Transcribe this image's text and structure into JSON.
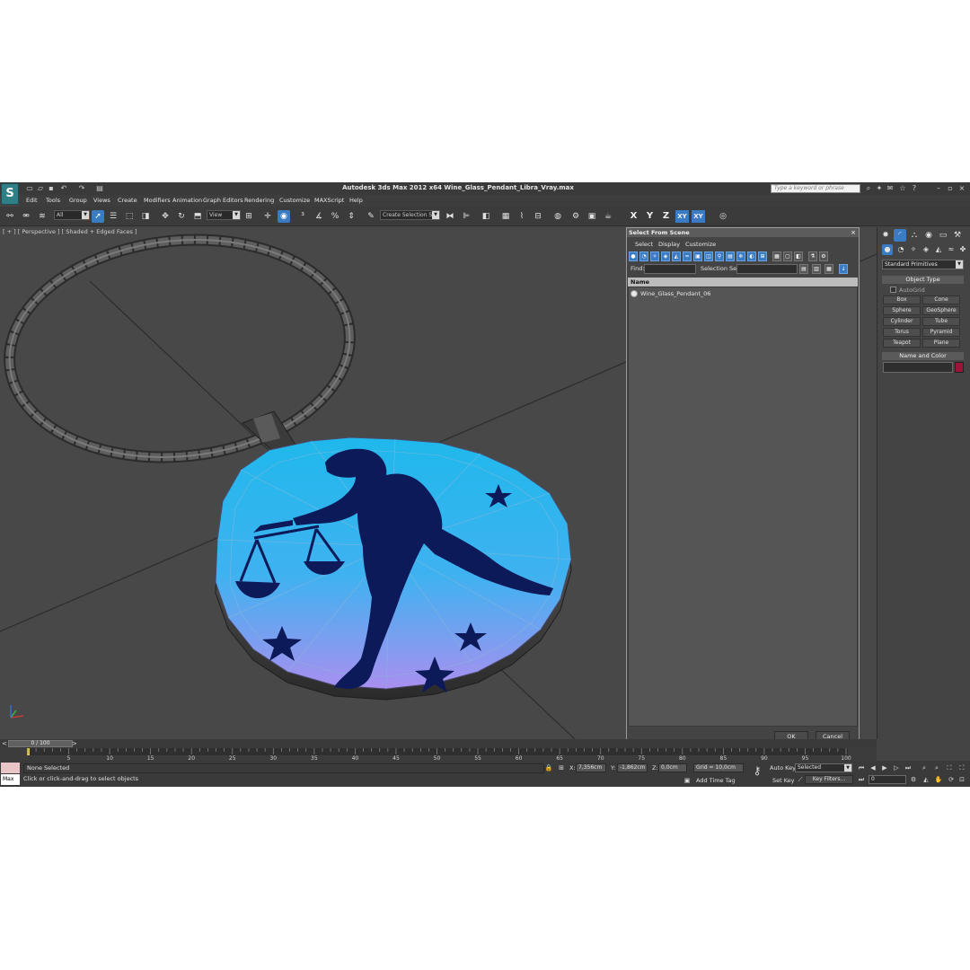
{
  "window": {
    "title": "Autodesk 3ds Max  2012 x64     Wine_Glass_Pendant_Libra_Vray.max",
    "search_placeholder": "Type a keyword or phrase",
    "logo": "S"
  },
  "menu": [
    "Edit",
    "Tools",
    "Group",
    "Views",
    "Create",
    "Modifiers",
    "Animation",
    "Graph Editors",
    "Rendering",
    "Customize",
    "MAXScript",
    "Help"
  ],
  "toolbar": {
    "selection_filter": "All",
    "reference_coord": "View",
    "named_selection": "Create Selection Se",
    "axis_x": "X",
    "axis_y": "Y",
    "axis_z": "Z",
    "axis_xy": "XY",
    "axis_xy2": "XY"
  },
  "viewport": {
    "label": "[ + ] [ Perspective ] [ Shaded + Edged Faces ]"
  },
  "dialog": {
    "title": "Select From Scene",
    "menu": [
      "Select",
      "Display",
      "Customize"
    ],
    "find_label": "Find:",
    "selection_set_label": "Selection Set:",
    "column_header": "Name",
    "items": [
      "Wine_Glass_Pendant_06"
    ],
    "ok_label": "OK",
    "cancel_label": "Cancel"
  },
  "command_panel": {
    "category": "Standard Primitives",
    "object_type_title": "Object Type",
    "autogrid_label": "AutoGrid",
    "primitives": [
      "Box",
      "Cone",
      "Sphere",
      "GeoSphere",
      "Cylinder",
      "Tube",
      "Torus",
      "Pyramid",
      "Teapot",
      "Plane"
    ],
    "name_color_title": "Name and Color",
    "object_color": "#9c1437"
  },
  "timeline": {
    "slider_label": "0 / 100",
    "ticks": [
      "5",
      "10",
      "15",
      "20",
      "25",
      "30",
      "35",
      "40",
      "45",
      "50",
      "55",
      "60",
      "65",
      "70",
      "75",
      "80",
      "85",
      "90",
      "95",
      "100"
    ]
  },
  "status": {
    "maxscript_label": "Max",
    "selection_text": "None Selected",
    "prompt_text": "Click or click-and-drag to select objects",
    "x_label": "X:",
    "x_value": "7,356cm",
    "y_label": "Y:",
    "y_value": "-1,862cm",
    "z_label": "Z:",
    "z_value": "0,0cm",
    "grid_text": "Grid = 10,0cm",
    "add_time_tag": "Add Time Tag",
    "auto_key": "Auto Key",
    "set_key": "Set Key",
    "selected_dropdown": "Selected",
    "key_filters": "Key Filters...",
    "current_frame": "0"
  },
  "colors": {
    "selection_blue": "#3a7cc4",
    "pendant_top": "#1fb8ec",
    "pendant_bottom": "#a98ff0",
    "libra_figure": "#0d1a5a"
  }
}
